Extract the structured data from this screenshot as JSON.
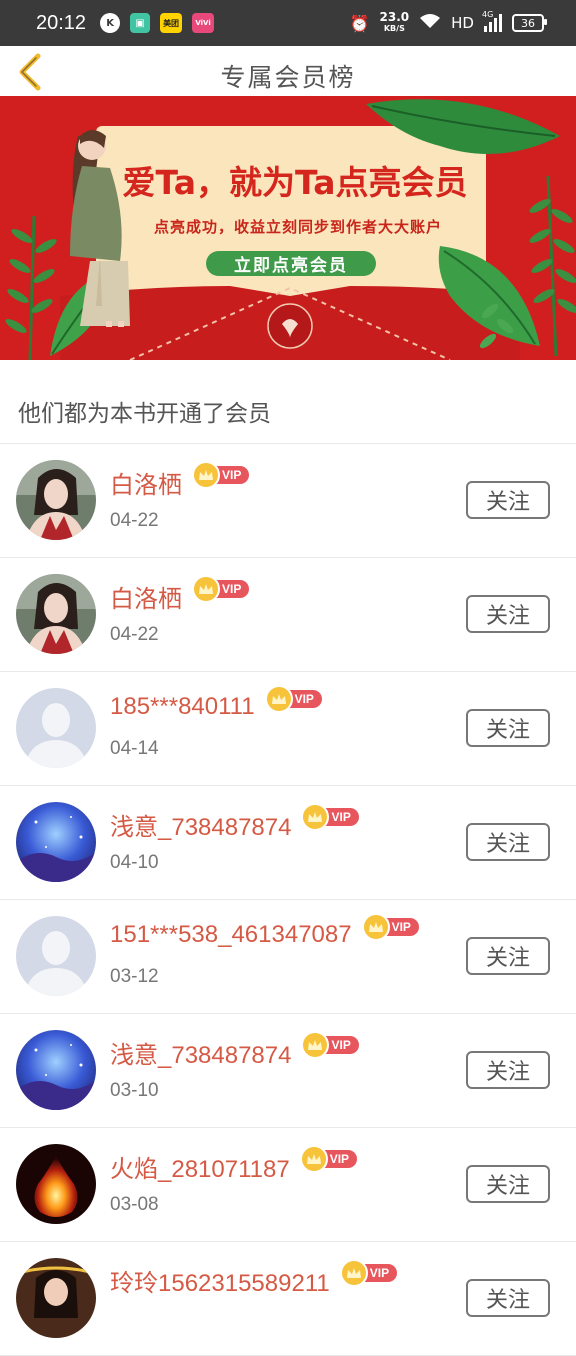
{
  "status_bar": {
    "time": "20:12",
    "app_icons": [
      "k-icon",
      "gift-app-icon",
      "meituan-icon",
      "vivo-icon"
    ],
    "app_labels": {
      "k": "K",
      "meituan": "美团",
      "vivo": "ViVi"
    },
    "speed_value": "23.0",
    "speed_unit": "KB/S",
    "network": "HD",
    "signal_type": "4G",
    "battery": "36"
  },
  "header": {
    "title": "专属会员榜"
  },
  "banner": {
    "title": "爱Ta，就为Ta点亮会员",
    "subtitle": "点亮成功，收益立刻同步到作者大大账户",
    "button_label": "立即点亮会员"
  },
  "section": {
    "title": "他们都为本书开通了会员"
  },
  "members": [
    {
      "name": "白洛栖",
      "date": "04-22",
      "badge": "VIP",
      "follow_label": "关注",
      "avatar": "girl"
    },
    {
      "name": "白洛栖",
      "date": "04-22",
      "badge": "VIP",
      "follow_label": "关注",
      "avatar": "girl"
    },
    {
      "name": "185***840111",
      "date": "04-14",
      "badge": "VIP",
      "follow_label": "关注",
      "avatar": "default"
    },
    {
      "name": "浅意_738487874",
      "date": "04-10",
      "badge": "VIP",
      "follow_label": "关注",
      "avatar": "galaxy"
    },
    {
      "name": "151***538_461347087",
      "date": "03-12",
      "badge": "VIP",
      "follow_label": "关注",
      "avatar": "default"
    },
    {
      "name": "浅意_738487874",
      "date": "03-10",
      "badge": "VIP",
      "follow_label": "关注",
      "avatar": "galaxy"
    },
    {
      "name": "火焰_281071187",
      "date": "03-08",
      "badge": "VIP",
      "follow_label": "关注",
      "avatar": "fire"
    },
    {
      "name": "玲玲1562315589211",
      "date": "",
      "badge": "VIP",
      "follow_label": "关注",
      "avatar": "woman"
    }
  ],
  "colors": {
    "name": "#d55a45",
    "vip_tag": "#e8565d",
    "crown": "#f6c33a",
    "banner_red": "#d11f1f",
    "banner_button": "#3f9b4a"
  }
}
